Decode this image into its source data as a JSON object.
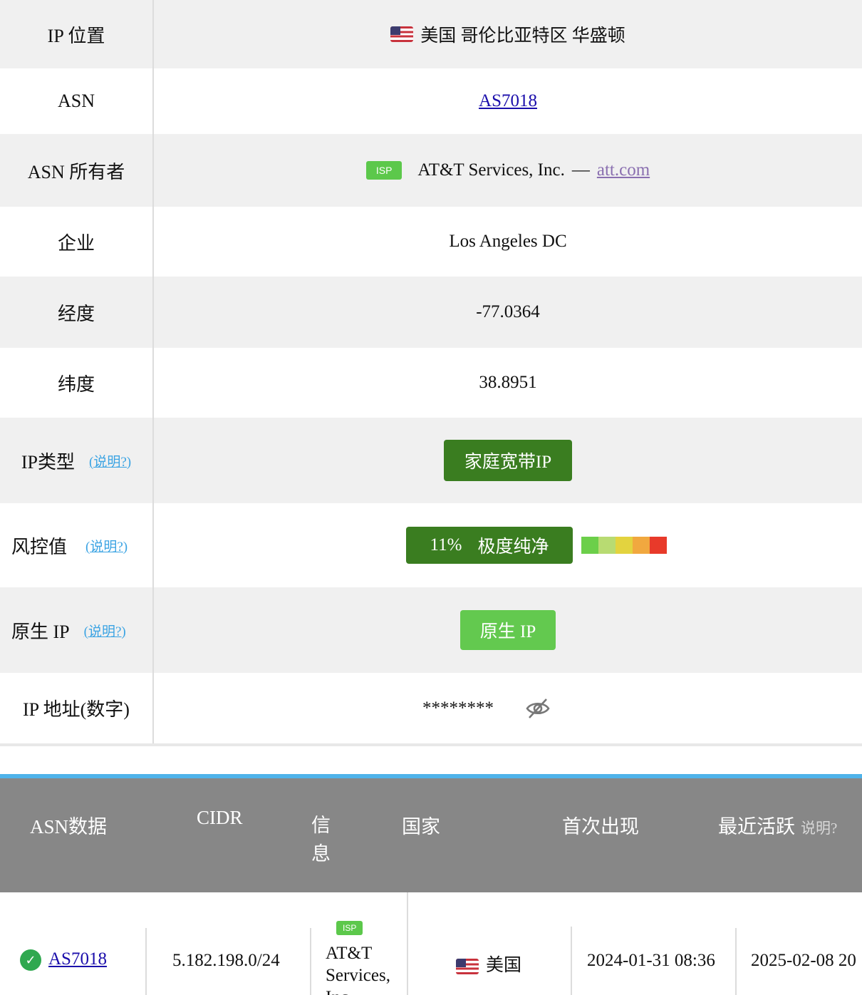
{
  "info_rows": {
    "ip_location": {
      "label": "IP 位置",
      "value": "美国 哥伦比亚特区 华盛顿",
      "flag": "us-flag-icon"
    },
    "asn": {
      "label": "ASN",
      "value": "AS7018"
    },
    "asn_owner": {
      "label": "ASN 所有者",
      "tag": "ISP",
      "name": "AT&T Services, Inc.",
      "separator": "—",
      "domain": "att.com"
    },
    "company": {
      "label": "企业",
      "value": "Los Angeles DC"
    },
    "longitude": {
      "label": "经度",
      "value": "-77.0364"
    },
    "latitude": {
      "label": "纬度",
      "value": "38.8951"
    },
    "ip_type": {
      "label": "IP类型",
      "help": "(说明?)",
      "value": "家庭宽带IP"
    },
    "risk": {
      "label": "风控值",
      "help": "(说明?)",
      "percent": "11%",
      "level": "极度纯净",
      "scale_colors": [
        "#6ccf4a",
        "#b8db72",
        "#e3d33f",
        "#f1a83f",
        "#e83a2a"
      ]
    },
    "native_ip": {
      "label": "原生 IP",
      "help": "(说明?)",
      "value": "原生 IP"
    },
    "ip_numeric": {
      "label": "IP 地址(数字)",
      "value": "********",
      "icon": "eye-hidden-icon"
    }
  },
  "asn_table": {
    "headers": {
      "asn": "ASN数据",
      "cidr": "CIDR",
      "info": "信息",
      "country": "国家",
      "first_seen": "首次出现",
      "last_active": "最近活跃",
      "help": "说明?"
    },
    "row": {
      "asn": "AS7018",
      "cidr": "5.182.198.0/24",
      "tag": "ISP",
      "info_line1": "AT&T",
      "info_line2": "Services,",
      "info_line3": "Inc.",
      "country": "美国",
      "first_seen": "2024-01-31 08:36",
      "last_active": "2025-02-08 20"
    }
  },
  "colors": {
    "dark_green": "#3a7d20",
    "light_green": "#63c94f",
    "accent_blue": "#4fb3ea",
    "header_gray": "#878787"
  }
}
